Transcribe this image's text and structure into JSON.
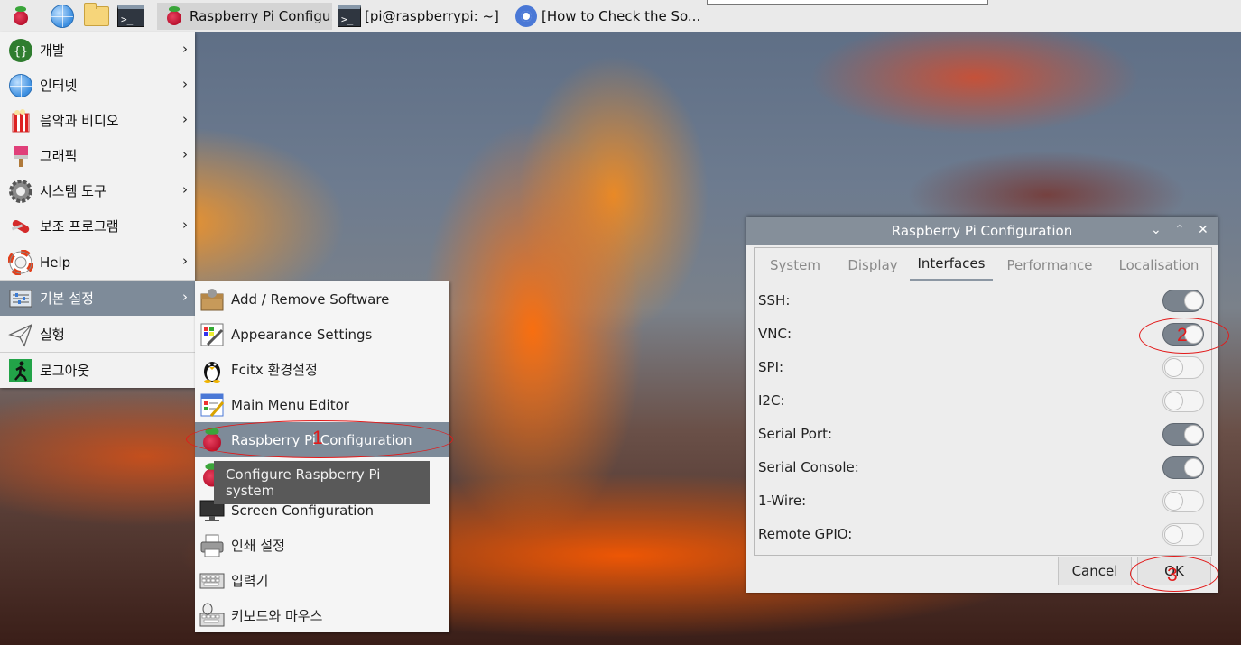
{
  "taskbar": {
    "tasks": [
      {
        "label": "Raspberry Pi Configu...",
        "icon": "raspberry-icon"
      },
      {
        "label": "[pi@raspberrypi: ~]",
        "icon": "terminal-icon"
      },
      {
        "label": "[How to Check the So...",
        "icon": "chromium-icon"
      }
    ],
    "terminal_glyph": ">_"
  },
  "main_menu": {
    "items": [
      {
        "label": "개발",
        "icon": "programming-icon"
      },
      {
        "label": "인터넷",
        "icon": "internet-globe-icon"
      },
      {
        "label": "음악과 비디오",
        "icon": "popcorn-icon"
      },
      {
        "label": "그래픽",
        "icon": "paintbrush-icon"
      },
      {
        "label": "시스템 도구",
        "icon": "gear-icon"
      },
      {
        "label": "보조 프로그램",
        "icon": "knife-icon"
      },
      {
        "label": "Help",
        "icon": "lifebuoy-icon"
      },
      {
        "label": "기본 설정",
        "icon": "preferences-icon",
        "selected": true
      },
      {
        "label": "실행",
        "icon": "paper-plane-icon"
      },
      {
        "label": "로그아웃",
        "icon": "exit-icon"
      }
    ],
    "arrow": "›"
  },
  "submenu": {
    "items": [
      {
        "label": "Add / Remove Software",
        "icon": "package-icon"
      },
      {
        "label": "Appearance Settings",
        "icon": "palette-icon"
      },
      {
        "label": "Fcitx 환경설정",
        "icon": "penguin-icon"
      },
      {
        "label": "Main Menu Editor",
        "icon": "menu-editor-icon"
      },
      {
        "label": "Raspberry Pi Configuration",
        "icon": "raspberry-icon",
        "selected": true
      },
      {
        "label": "",
        "icon": "raspberry-icon"
      },
      {
        "label": "Screen Configuration",
        "icon": "monitor-icon"
      },
      {
        "label": "인쇄 설정",
        "icon": "printer-icon"
      },
      {
        "label": "입력기",
        "icon": "keyboard-icon"
      },
      {
        "label": "키보드와 마우스",
        "icon": "keyboard-mouse-icon"
      }
    ],
    "tooltip": "Configure Raspberry Pi system"
  },
  "config_window": {
    "title": "Raspberry Pi Configuration",
    "controls": {
      "minimize": "⌄",
      "maximize": "⌃",
      "close": "✕"
    },
    "tabs": [
      {
        "label": "System",
        "active": false
      },
      {
        "label": "Display",
        "active": false
      },
      {
        "label": "Interfaces",
        "active": true
      },
      {
        "label": "Performance",
        "active": false
      },
      {
        "label": "Localisation",
        "active": false
      }
    ],
    "options": [
      {
        "label": "SSH:",
        "enabled": true
      },
      {
        "label": "VNC:",
        "enabled": true
      },
      {
        "label": "SPI:",
        "enabled": false
      },
      {
        "label": "I2C:",
        "enabled": false
      },
      {
        "label": "Serial Port:",
        "enabled": true
      },
      {
        "label": "Serial Console:",
        "enabled": true
      },
      {
        "label": "1-Wire:",
        "enabled": false
      },
      {
        "label": "Remote GPIO:",
        "enabled": false
      }
    ],
    "cancel_label": "Cancel",
    "ok_label": "OK"
  },
  "annotations": {
    "step1": "1",
    "step2": "2",
    "step3": "3",
    "color": "#e21a1a"
  }
}
